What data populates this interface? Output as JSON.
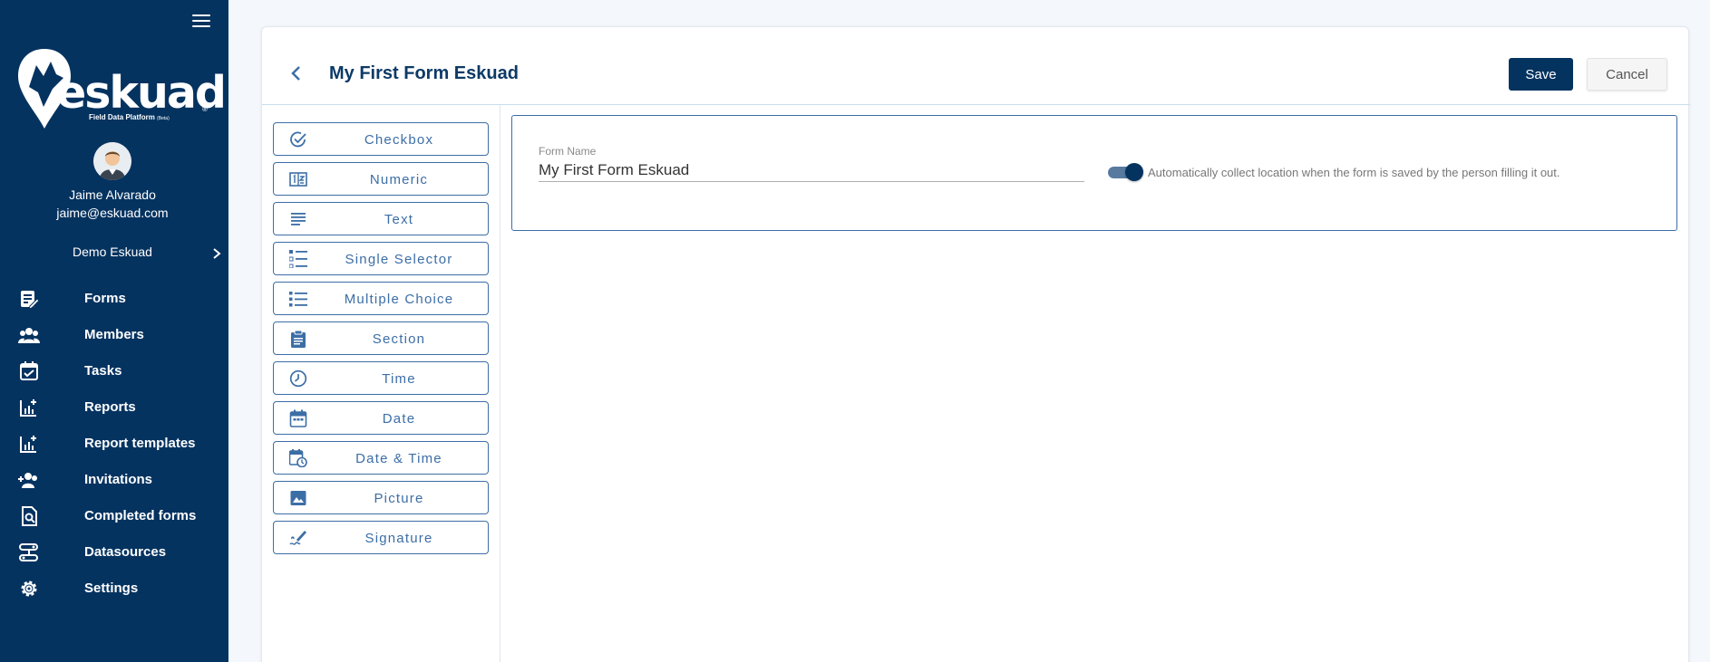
{
  "sidebar": {
    "brand": {
      "name": "eskuad",
      "tagline": "Field Data Platform",
      "tag": "(Beta)",
      "reg": "®"
    },
    "user": {
      "name": "Jaime Alvarado",
      "email": "jaime@eskuad.com"
    },
    "organization": "Demo Eskuad",
    "nav": [
      {
        "label": "Forms",
        "icon": "forms-icon"
      },
      {
        "label": "Members",
        "icon": "members-icon"
      },
      {
        "label": "Tasks",
        "icon": "tasks-icon"
      },
      {
        "label": "Reports",
        "icon": "reports-icon"
      },
      {
        "label": "Report templates",
        "icon": "report-templates-icon"
      },
      {
        "label": "Invitations",
        "icon": "invitations-icon"
      },
      {
        "label": "Completed forms",
        "icon": "completed-forms-icon"
      },
      {
        "label": "Datasources",
        "icon": "datasources-icon"
      },
      {
        "label": "Settings",
        "icon": "settings-icon"
      }
    ]
  },
  "header": {
    "title": "My First Form Eskuad",
    "save_label": "Save",
    "cancel_label": "Cancel"
  },
  "palette": [
    {
      "label": "Checkbox",
      "icon": "checkbox-icon"
    },
    {
      "label": "Numeric",
      "icon": "numeric-icon"
    },
    {
      "label": "Text",
      "icon": "text-icon"
    },
    {
      "label": "Single Selector",
      "icon": "single-selector-icon"
    },
    {
      "label": "Multiple Choice",
      "icon": "multiple-choice-icon"
    },
    {
      "label": "Section",
      "icon": "section-icon"
    },
    {
      "label": "Time",
      "icon": "time-icon"
    },
    {
      "label": "Date",
      "icon": "date-icon"
    },
    {
      "label": "Date & Time",
      "icon": "date-time-icon"
    },
    {
      "label": "Picture",
      "icon": "picture-icon"
    },
    {
      "label": "Signature",
      "icon": "signature-icon"
    }
  ],
  "form_settings": {
    "name_label": "Form Name",
    "name_value": "My First Form Eskuad",
    "location_toggle_on": true,
    "location_label": "Automatically collect location when the form is saved by the person filling it out."
  },
  "colors": {
    "sidebar": "#053360",
    "accent": "#3c6ea6",
    "primary_button": "#053360"
  }
}
